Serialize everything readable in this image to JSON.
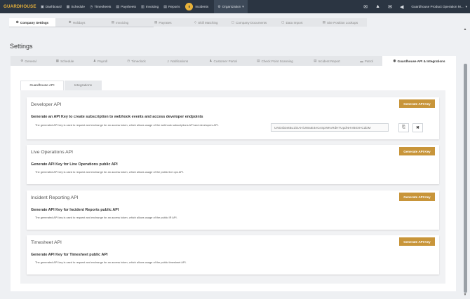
{
  "topnav": {
    "logo": "GUARDHOUSE",
    "items": [
      {
        "icon": "dashboard-icon",
        "glyph": "▣",
        "label": "Dashboard"
      },
      {
        "icon": "schedule-icon",
        "glyph": "▦",
        "label": "Schedule"
      },
      {
        "icon": "timesheets-icon",
        "glyph": "◷",
        "label": "Timesheets"
      },
      {
        "icon": "paysheets-icon",
        "glyph": "▤",
        "label": "Paysheets"
      },
      {
        "icon": "invoicing-icon",
        "glyph": "▥",
        "label": "Invoicing"
      },
      {
        "icon": "reports-icon",
        "glyph": "▤",
        "label": "Reports"
      }
    ],
    "incidents": {
      "badge": "0",
      "label": "Incidents"
    },
    "organization": {
      "label": "Organization",
      "caret": "▾"
    },
    "right_icons": [
      {
        "name": "chat-icon",
        "glyph": "✉"
      },
      {
        "name": "graduation-cap-icon",
        "glyph": "▲"
      },
      {
        "name": "mail-icon",
        "glyph": "✉"
      },
      {
        "name": "megaphone-icon",
        "glyph": "◀"
      }
    ],
    "user": "Guardhouse Product Operation M...",
    "user_caret": "▾"
  },
  "module_tabs": [
    {
      "icon": "gear-icon",
      "glyph": "⚙",
      "label": "Company Settings",
      "active": true
    },
    {
      "icon": "holidays-icon",
      "glyph": "✱",
      "label": "Holidays",
      "active": false
    },
    {
      "icon": "invoicing-icon",
      "glyph": "▤",
      "label": "Invoicing",
      "active": false
    },
    {
      "icon": "payrates-icon",
      "glyph": "▤",
      "label": "Payrates",
      "active": false
    },
    {
      "icon": "skill-matching-icon",
      "glyph": "◇",
      "label": "Skill Matching",
      "active": false
    },
    {
      "icon": "company-documents-icon",
      "glyph": "▢",
      "label": "Company Documents",
      "active": false
    },
    {
      "icon": "data-import-icon",
      "glyph": "▢",
      "label": "Data Import",
      "active": false
    },
    {
      "icon": "site-position-icon",
      "glyph": "▤",
      "label": "Site Position Lookups",
      "active": false
    }
  ],
  "page_title": "Settings",
  "settings_tabs": [
    {
      "icon": "gear-icon",
      "glyph": "⚙",
      "label": "General",
      "active": false
    },
    {
      "icon": "calendar-icon",
      "glyph": "▦",
      "label": "Schedule",
      "active": false
    },
    {
      "icon": "payroll-icon",
      "glyph": "♟",
      "label": "Payroll",
      "active": false
    },
    {
      "icon": "clock-icon",
      "glyph": "◷",
      "label": "Timeclock",
      "active": false
    },
    {
      "icon": "bell-icon",
      "glyph": "♫",
      "label": "Notifications",
      "active": false
    },
    {
      "icon": "user-icon",
      "glyph": "♟",
      "label": "Customer Portal",
      "active": false
    },
    {
      "icon": "scan-icon",
      "glyph": "▤",
      "label": "Check Point Scanning",
      "active": false
    },
    {
      "icon": "report-icon",
      "glyph": "▤",
      "label": "Incident Report",
      "active": false
    },
    {
      "icon": "car-icon",
      "glyph": "▬",
      "label": "Patrol",
      "active": false
    },
    {
      "icon": "globe-icon",
      "glyph": "◍",
      "label": "Guardhouse API & Integrations",
      "active": true
    }
  ],
  "sub_tabs": [
    {
      "label": "Guardhouse API",
      "active": true
    },
    {
      "label": "Integrations",
      "active": false
    }
  ],
  "cards": [
    {
      "title": "Developer API",
      "button": "Generate API Key",
      "heading": "Generate an API Key to create subscription to webhook events and access developer endpoints",
      "description": "The generated API key is used to request and exchange for an access token, which allows usage of the webhook subscriptions API and developers API.",
      "api_key": "UNGsb3etBu1iOAHiUWaIE4eCeSpWKvRdHTUpdNHVB0XHCdDM"
    },
    {
      "title": "Live Operations API",
      "button": "Generate API Key",
      "heading": "Generate API Key for Live Operations public API",
      "description": "The generated API key is used to request and exchange for an access token, which allows usage of the public live ops API."
    },
    {
      "title": "Incident Reporting API",
      "button": "Generate API Key",
      "heading": "Generate API Key for Incident Reports public API",
      "description": "The generated API key is used to request and exchange for an access token, which allows usage of the public IR API."
    },
    {
      "title": "Timesheet API",
      "button": "Generate API Key",
      "heading": "Generate API Key for Timesheet public API",
      "description": "The generated API key is used to request and exchange for an access token, which allows usage of the public timesheet API."
    }
  ],
  "key_actions": {
    "copy_glyph": "⎘",
    "clear_glyph": "✖"
  },
  "scrollbar": {
    "up": "▲",
    "down": "▼"
  }
}
